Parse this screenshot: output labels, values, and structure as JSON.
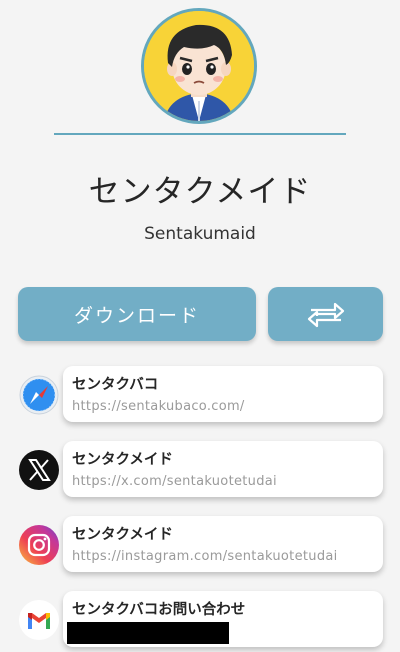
{
  "profile": {
    "name": "センタクメイド",
    "handle": "Sentakumaid"
  },
  "buttons": {
    "download_label": "ダウンロード",
    "share_icon": "swap-arrows-icon"
  },
  "links": [
    {
      "title": "センタクバコ",
      "url": "https://sentakubaco.com/",
      "icon": "safari-icon"
    },
    {
      "title": "センタクメイド",
      "url": "https://x.com/sentakuotetudai",
      "icon": "x-icon"
    },
    {
      "title": "センタクメイド",
      "url": "https://instagram.com/sentakuotetudai",
      "icon": "instagram-icon"
    },
    {
      "title": "センタクバコお問い合わせ",
      "url": "",
      "icon": "gmail-icon"
    }
  ],
  "colors": {
    "accent": "#72aec6",
    "avatar_bg": "#f8d337",
    "background": "#f4f4f4"
  }
}
